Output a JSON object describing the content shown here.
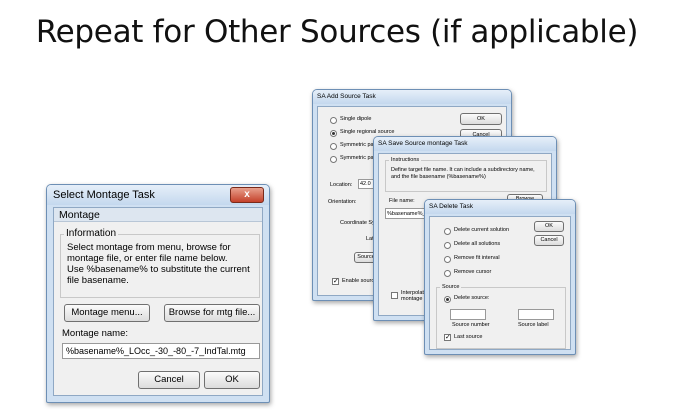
{
  "slide": {
    "title": "Repeat for Other Sources (if applicable)"
  },
  "montage_dialog": {
    "title": "Select Montage Task",
    "close": "x",
    "tab": "Montage",
    "info_group": "Information",
    "info_text": "Select montage from menu, browse for montage file, or enter file name below.\nUse %basename% to substitute the current file basename.",
    "montage_menu_button": "Montage menu...",
    "browse_button": "Browse for mtg file...",
    "name_label": "Montage name:",
    "name_value": "%basename%_LOcc_-30_-80_-7_IndTal.mtg",
    "cancel_button": "Cancel",
    "ok_button": "OK"
  },
  "add_source_dialog": {
    "title": "SA Add Source Task",
    "ok_button": "OK",
    "cancel_button": "Cancel",
    "options": [
      {
        "label": "Single dipole",
        "selected": false
      },
      {
        "label": "Single regional source",
        "selected": true
      },
      {
        "label": "Symmetric pair o",
        "selected": false
      },
      {
        "label": "Symmetric pair o",
        "selected": false
      }
    ],
    "location_label": "Location:",
    "location_value": "42.0",
    "orientation_label": "Orientation:",
    "coord_label": "Coordinate Syste",
    "lat_label": "Lat",
    "source_button": "Source",
    "enable_label": "Enable source"
  },
  "save_montage_dialog": {
    "title": "SA Save Source montage Task",
    "instructions_group": "Instructions",
    "instructions_text": "Define target file name. It can include a subdirectory name, and the file basename (%basename%)",
    "file_name_label": "File name:",
    "browse_button": "Browse",
    "file_value": "%basename%_RP",
    "interpolate_label": "Interpolate montage ("
  },
  "delete_dialog": {
    "title": "SA Delete Task",
    "ok_button": "OK",
    "cancel_button": "Cancel",
    "options": [
      {
        "label": "Delete current solution",
        "selected": false
      },
      {
        "label": "Delete all solutions",
        "selected": false
      },
      {
        "label": "Remove fit interval",
        "selected": false
      },
      {
        "label": "Remove cursor",
        "selected": false
      }
    ],
    "source_group": "Source",
    "delete_source_label": "Delete source:",
    "source_number_label": "Source number",
    "source_label_label": "Source label",
    "last_source_label": "Last source",
    "check_mark": "✓"
  }
}
